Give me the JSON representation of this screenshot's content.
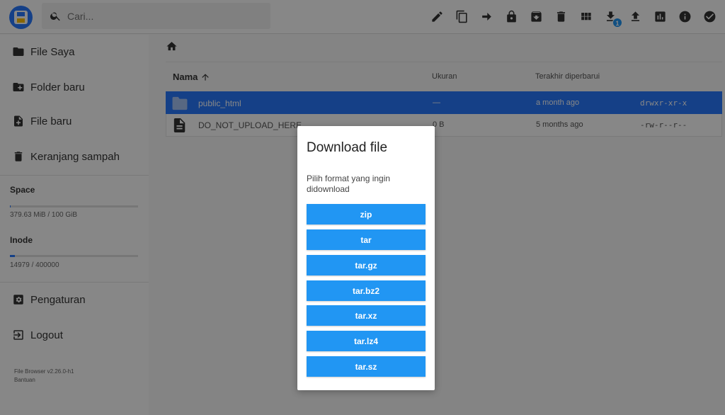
{
  "header": {
    "search_placeholder": "Cari...",
    "toolbar": [
      "edit-icon",
      "copy-icon",
      "move-icon",
      "lock-icon",
      "archive-icon",
      "delete-icon",
      "grid-view-icon",
      "download-icon",
      "upload-icon",
      "info-chart-icon",
      "info-icon",
      "select-check-icon"
    ],
    "download_badge": "1"
  },
  "sidebar": {
    "items": [
      {
        "label": "File Saya",
        "icon": "folder-icon"
      },
      {
        "label": "Folder baru",
        "icon": "new-folder-icon"
      },
      {
        "label": "File baru",
        "icon": "new-file-icon"
      },
      {
        "label": "Keranjang sampah",
        "icon": "trash-icon"
      }
    ],
    "space": {
      "title": "Space",
      "text": "379.63 MiB / 100 GiB",
      "fraction": 0.0037
    },
    "inode": {
      "title": "Inode",
      "text": "14979 / 400000",
      "fraction": 0.0374
    },
    "settings_label": "Pengaturan",
    "logout_label": "Logout",
    "version": "File Browser v2.26.0-h1",
    "help": "Bantuan"
  },
  "listing": {
    "headers": {
      "name": "Nama",
      "size": "Ukuran",
      "modified": "Terakhir diperbarui"
    },
    "rows": [
      {
        "name": "public_html",
        "size": "—",
        "modified": "a month ago",
        "perm": "drwxr-xr-x",
        "type": "folder",
        "selected": true
      },
      {
        "name": "DO_NOT_UPLOAD_HERE",
        "size": "0 B",
        "modified": "5 months ago",
        "perm": "-rw-r--r--",
        "type": "file",
        "selected": false
      }
    ]
  },
  "dialog": {
    "title": "Download file",
    "message": "Pilih format yang ingin didownload",
    "formats": [
      "zip",
      "tar",
      "tar.gz",
      "tar.bz2",
      "tar.xz",
      "tar.lz4",
      "tar.sz"
    ]
  },
  "colors": {
    "accent": "#2979ff",
    "button": "#2196f3"
  }
}
